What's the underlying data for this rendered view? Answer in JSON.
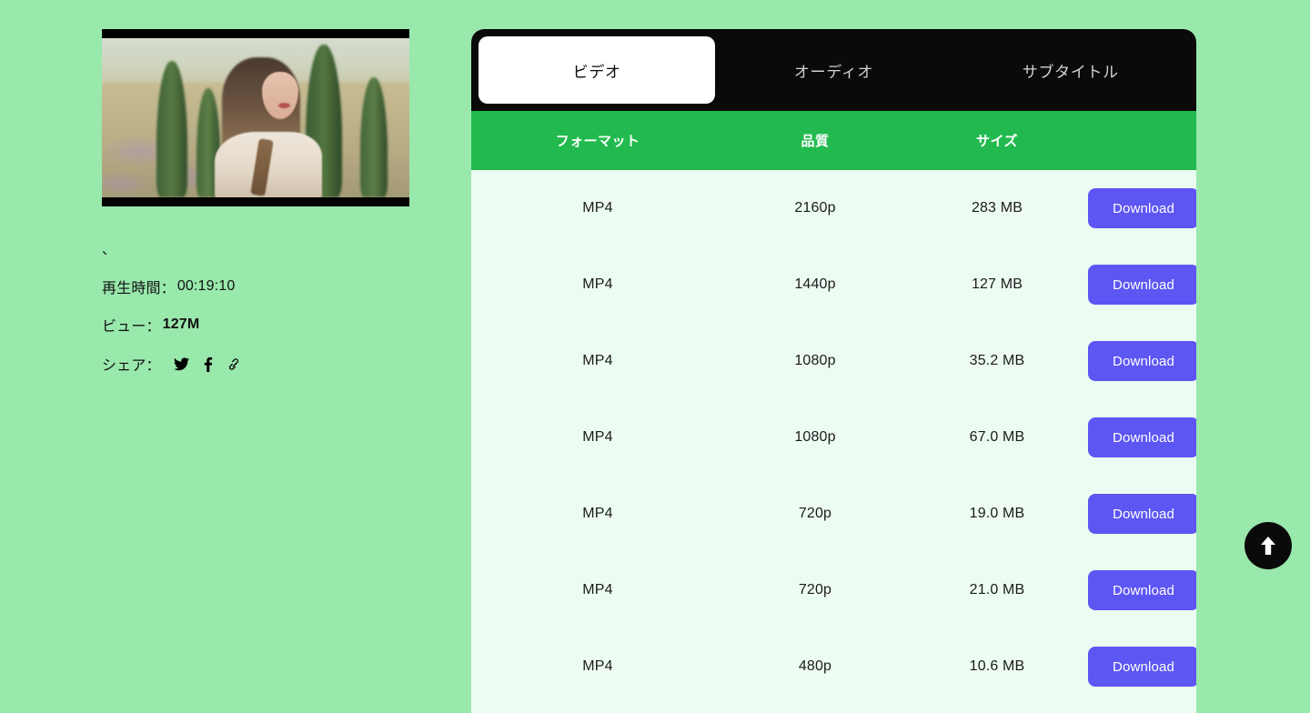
{
  "theme": {
    "page_background": "#99E8AC",
    "tabbar_background": "#0A0A0A",
    "table_header_green": "#22BA4E",
    "table_body_mint": "#EDFCF2",
    "download_button": "#5D56F3",
    "active_tab_background": "#FFFFFF"
  },
  "video": {
    "title": "、",
    "duration_label": "再生時間：",
    "duration_value": "00:19:10",
    "views_label": "ビュー：",
    "views_value": "127M",
    "share_label": "シェア：",
    "share_icons": [
      "twitter-icon",
      "facebook-icon",
      "link-icon"
    ]
  },
  "tabs": [
    {
      "label": "ビデオ",
      "name": "tab-video",
      "active": true
    },
    {
      "label": "オーディオ",
      "name": "tab-audio",
      "active": false
    },
    {
      "label": "サブタイトル",
      "name": "tab-subtitle",
      "active": false
    }
  ],
  "table": {
    "headers": {
      "format": "フォーマット",
      "quality": "品質",
      "size": "サイズ",
      "action": ""
    },
    "rows": [
      {
        "format": "MP4",
        "quality": "2160p",
        "size": "283 MB",
        "action": "Download"
      },
      {
        "format": "MP4",
        "quality": "1440p",
        "size": "127 MB",
        "action": "Download"
      },
      {
        "format": "MP4",
        "quality": "1080p",
        "size": "35.2 MB",
        "action": "Download"
      },
      {
        "format": "MP4",
        "quality": "1080p",
        "size": "67.0 MB",
        "action": "Download"
      },
      {
        "format": "MP4",
        "quality": "720p",
        "size": "19.0 MB",
        "action": "Download"
      },
      {
        "format": "MP4",
        "quality": "720p",
        "size": "21.0 MB",
        "action": "Download"
      },
      {
        "format": "MP4",
        "quality": "480p",
        "size": "10.6 MB",
        "action": "Download"
      }
    ]
  },
  "scroll_top": {
    "icon": "arrow-up-icon",
    "label": ""
  }
}
